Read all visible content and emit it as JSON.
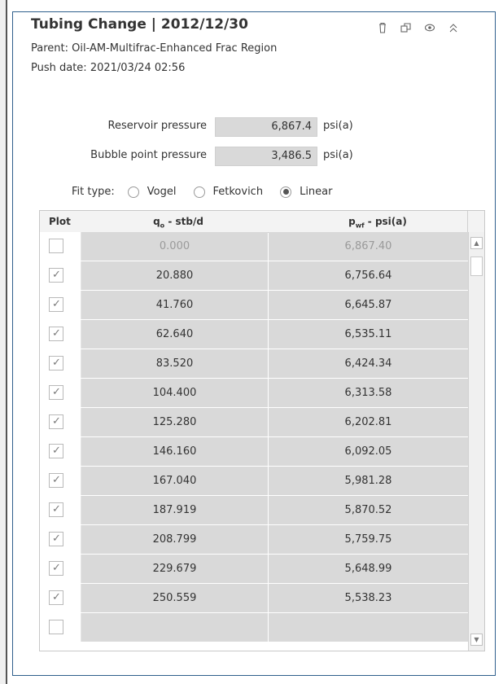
{
  "header": {
    "title": "Tubing Change | 2012/12/30",
    "parent": "Parent: Oil-AM-Multifrac-Enhanced Frac Region",
    "push_date": "Push date: 2021/03/24 02:56",
    "icons": [
      "trash-icon",
      "duplicate-icon",
      "eye-icon",
      "collapse-chevrons-icon"
    ]
  },
  "fields": {
    "reservoir_pressure": {
      "label": "Reservoir pressure",
      "value": "6,867.4",
      "unit": "psi(a)"
    },
    "bubble_point_pressure": {
      "label": "Bubble point pressure",
      "value": "3,486.5",
      "unit": "psi(a)"
    }
  },
  "fit": {
    "label": "Fit type:",
    "options": [
      "Vogel",
      "Fetkovich",
      "Linear"
    ],
    "selected": "Linear"
  },
  "table": {
    "headers": {
      "plot": "Plot",
      "q_main": "q",
      "q_sub": "o",
      "q_unit": " - stb/d",
      "p_main": "p",
      "p_sub": "wf",
      "p_unit": " - psi(a)"
    },
    "rows": [
      {
        "checked": false,
        "q": "0.000",
        "p": "6,867.40",
        "disabled": true
      },
      {
        "checked": true,
        "q": "20.880",
        "p": "6,756.64"
      },
      {
        "checked": true,
        "q": "41.760",
        "p": "6,645.87"
      },
      {
        "checked": true,
        "q": "62.640",
        "p": "6,535.11"
      },
      {
        "checked": true,
        "q": "83.520",
        "p": "6,424.34"
      },
      {
        "checked": true,
        "q": "104.400",
        "p": "6,313.58"
      },
      {
        "checked": true,
        "q": "125.280",
        "p": "6,202.81"
      },
      {
        "checked": true,
        "q": "146.160",
        "p": "6,092.05"
      },
      {
        "checked": true,
        "q": "167.040",
        "p": "5,981.28"
      },
      {
        "checked": true,
        "q": "187.919",
        "p": "5,870.52"
      },
      {
        "checked": true,
        "q": "208.799",
        "p": "5,759.75"
      },
      {
        "checked": true,
        "q": "229.679",
        "p": "5,648.99"
      },
      {
        "checked": true,
        "q": "250.559",
        "p": "5,538.23"
      },
      {
        "checked": false,
        "q": "",
        "p": ""
      }
    ]
  },
  "colors": {
    "border": "#2f5f8c",
    "cell": "#d9d9d9"
  }
}
